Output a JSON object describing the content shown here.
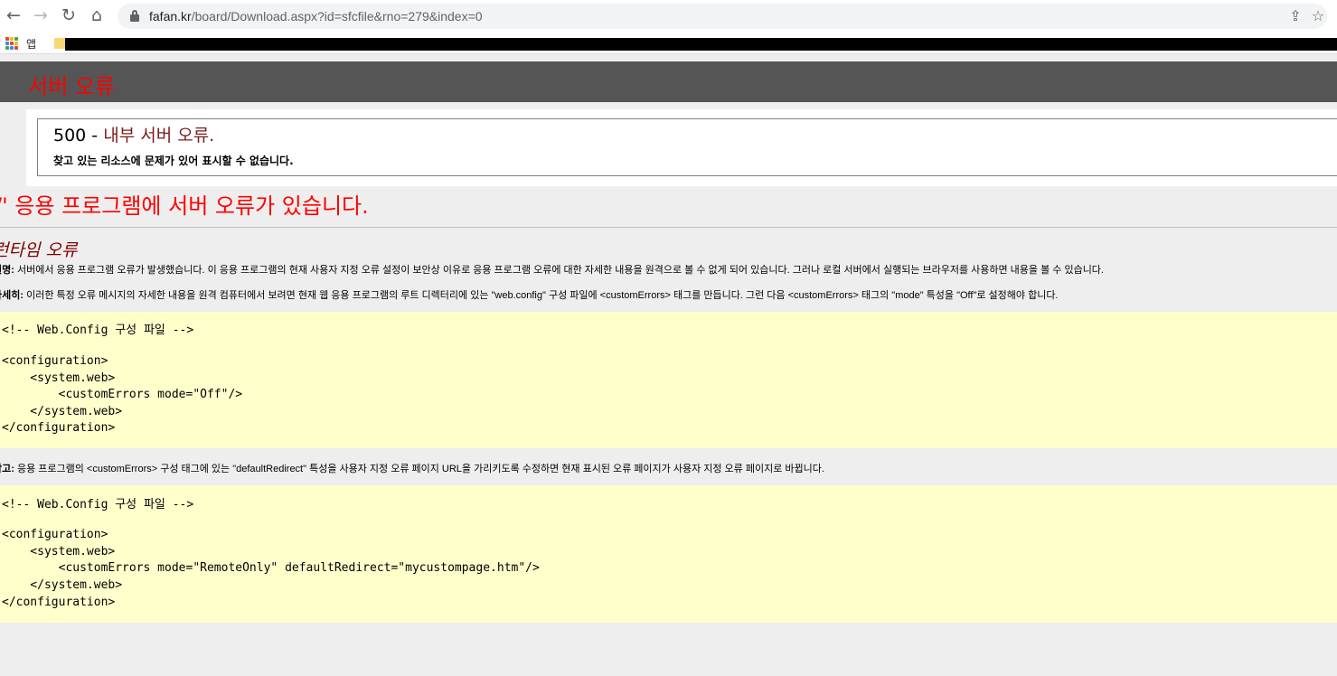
{
  "browser": {
    "nav": {
      "back": "←",
      "forward": "→",
      "reload": "↻",
      "home": "⌂"
    },
    "url_host": "fafan.kr",
    "url_path": "/board/Download.aspx?id=sfcfile&rno=279&index=0",
    "share_icon": "⇪",
    "star_icon": "☆",
    "bookmarks": {
      "apps_label": "앱"
    },
    "colors": {
      "apps_grid": [
        "#ea4335",
        "#fbbc04",
        "#34a853",
        "#4285f4",
        "#ea4335",
        "#fbbc04",
        "#34a853",
        "#4285f4",
        "#ea4335"
      ]
    }
  },
  "page": {
    "banner_title": "서버 오류",
    "error_code": "500 -",
    "error_title": " 내부 서버 오류.",
    "error_subtitle": "찾고 있는 리소스에 문제가 있어 표시할 수 없습니다.",
    "app_error": "/' 응용 프로그램에 서버 오류가 있습니다.",
    "runtime_error": "런타임 오류",
    "description_label": "설명:",
    "description_text": " 서버에서 응용 프로그램 오류가 발생했습니다. 이 응용 프로그램의 현재 사용자 지정 오류 설정이 보안상 이유로 응용 프로그램 오류에 대한 자세한 내용을 원격으로 볼 수 없게 되어 있습니다. 그러나 로컬 서버에서 실행되는 브라우저를 사용하면 내용을 볼 수 있습니다.",
    "details_label": "자세히:",
    "details_text": " 이러한 특정 오류 메시지의 자세한 내용을 원격 컴퓨터에서 보려면 현재 웹 응용 프로그램의 루트 디렉터리에 있는 \"web.config\" 구성 파일에 <customErrors> 태그를 만듭니다. 그런 다음 <customErrors> 태그의 \"mode\" 특성을 \"Off\"로 설정해야 합니다.",
    "code1": [
      "<!-- Web.Config 구성 파일 -->",
      "<configuration>",
      "    <system.web>",
      "        <customErrors mode=\"Off\"/>",
      "    </system.web>",
      "</configuration>"
    ],
    "note_label": "참고:",
    "note_text": " 응용 프로그램의 <customErrors> 구성 태그에 있는 \"defaultRedirect\" 특성을 사용자 지정 오류 페이지 URL을 가리키도록 수정하면 현재 표시된 오류 페이지가 사용자 지정 오류 페이지로 바뀝니다.",
    "code2": [
      "<!-- Web.Config 구성 파일 -->",
      "<configuration>",
      "    <system.web>",
      "        <customErrors mode=\"RemoteOnly\" defaultRedirect=\"mycustompage.htm\"/>",
      "    </system.web>",
      "</configuration>"
    ]
  }
}
